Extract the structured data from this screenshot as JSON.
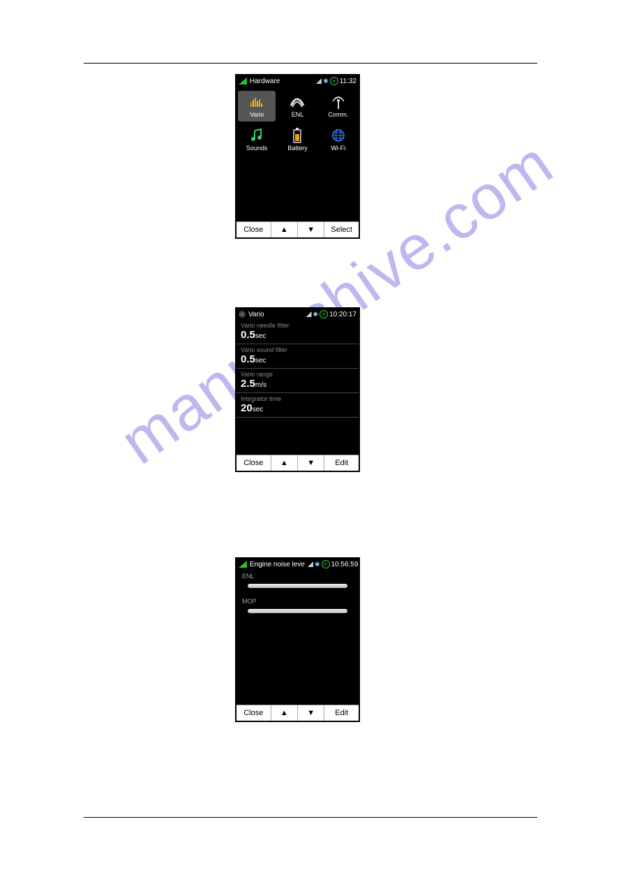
{
  "watermark": "manualshive.com",
  "screen1": {
    "title": "Hardware",
    "clock": "11:32",
    "items": [
      {
        "label": "Vario",
        "icon": "equalizer-icon",
        "selected": true
      },
      {
        "label": "ENL",
        "icon": "enl-icon"
      },
      {
        "label": "Comm.",
        "icon": "antenna-icon"
      },
      {
        "label": "Sounds",
        "icon": "music-icon"
      },
      {
        "label": "Battery",
        "icon": "battery-icon"
      },
      {
        "label": "Wi-Fi",
        "icon": "globe-icon"
      }
    ],
    "buttons": {
      "b1": "Close",
      "b2": "▲",
      "b3": "▼",
      "b4": "Select"
    }
  },
  "screen2": {
    "title": "Vario",
    "clock": "10:20:17",
    "rows": [
      {
        "label": "Vario needle filter",
        "value": "0.5",
        "unit": "sec"
      },
      {
        "label": "Vario sound filter",
        "value": "0.5",
        "unit": "sec"
      },
      {
        "label": "Vario range",
        "value": "2.5",
        "unit": "m/s"
      },
      {
        "label": "Integrator time",
        "value": "20",
        "unit": "sec"
      }
    ],
    "buttons": {
      "b1": "Close",
      "b2": "▲",
      "b3": "▼",
      "b4": "Edit"
    }
  },
  "screen3": {
    "title": "Engine noise leve",
    "clock": "10:56:59",
    "sliders": [
      {
        "label": "ENL"
      },
      {
        "label": "MOP"
      }
    ],
    "buttons": {
      "b1": "Close",
      "b2": "▲",
      "b3": "▼",
      "b4": "Edit"
    }
  }
}
